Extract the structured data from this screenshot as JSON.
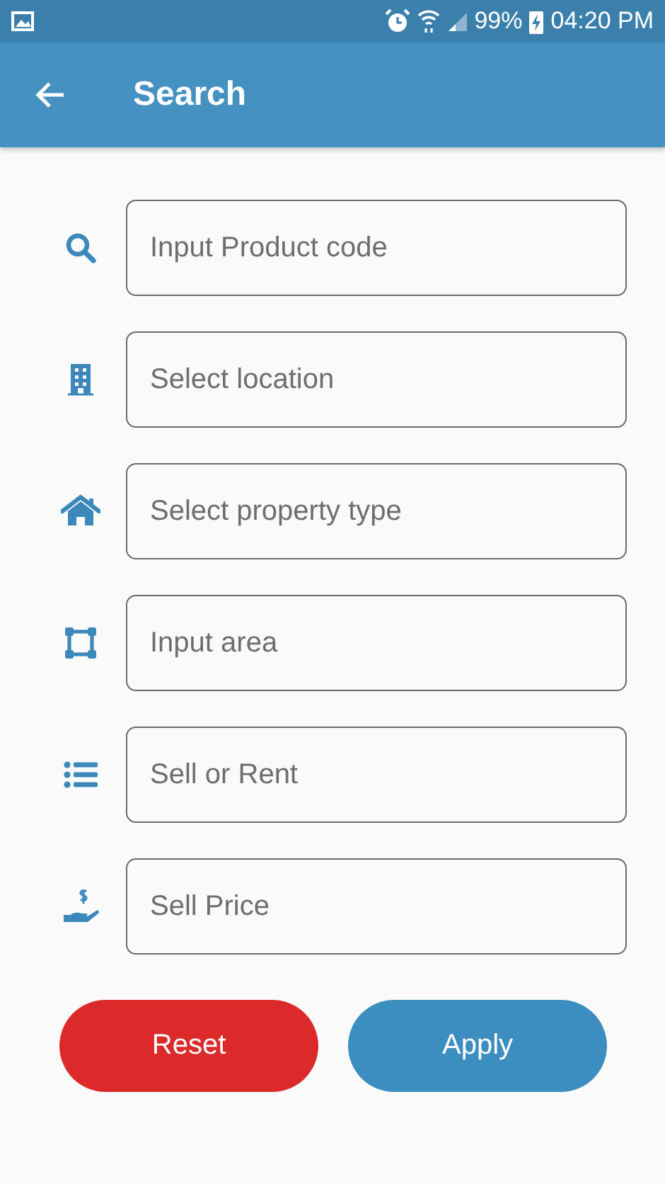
{
  "status_bar": {
    "battery": "99%",
    "time": "04:20 PM"
  },
  "app_bar": {
    "title": "Search"
  },
  "fields": [
    {
      "placeholder": "Input Product code"
    },
    {
      "placeholder": "Select location"
    },
    {
      "placeholder": "Select property type"
    },
    {
      "placeholder": "Input area"
    },
    {
      "placeholder": "Sell or Rent"
    },
    {
      "placeholder": "Sell Price"
    }
  ],
  "buttons": [
    {
      "label": "Reset",
      "kind": "reset"
    },
    {
      "label": "Apply",
      "kind": "apply"
    }
  ]
}
